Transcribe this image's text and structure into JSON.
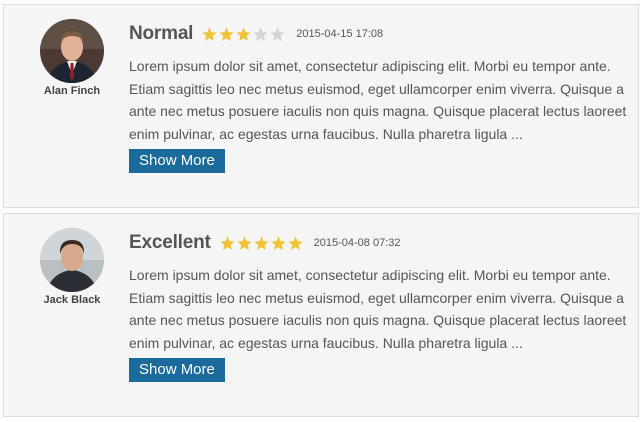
{
  "reviews": [
    {
      "author": "Alan Finch",
      "rating_title": "Normal",
      "rating": 3,
      "max_rating": 5,
      "timestamp": "2015-04-15 17:08",
      "text": "Lorem ipsum dolor sit amet, consectetur adipiscing elit. Morbi eu tempor ante. Etiam sagittis leo nec metus euismod, eget ullamcorper enim viverra. Quisque a ante nec metus posuere iaculis non quis magna. Quisque placerat lectus laoreet enim pulvinar, ac egestas urna faucibus. Nulla pharetra ligula ...",
      "button_label": "Show More"
    },
    {
      "author": "Jack Black",
      "rating_title": "Excellent",
      "rating": 5,
      "max_rating": 5,
      "timestamp": "2015-04-08 07:32",
      "text": "Lorem ipsum dolor sit amet, consectetur adipiscing elit. Morbi eu tempor ante. Etiam sagittis leo nec metus euismod, eget ullamcorper enim viverra. Quisque a ante nec metus posuere iaculis non quis magna. Quisque placerat lectus laoreet enim pulvinar, ac egestas urna faucibus. Nulla pharetra ligula ...",
      "button_label": "Show More"
    }
  ],
  "colors": {
    "star_filled": "#f0c43a",
    "star_empty": "#d5d5d5",
    "button_bg": "#1a6a9c"
  },
  "icons": {
    "star": "star-icon",
    "avatar": "avatar"
  }
}
